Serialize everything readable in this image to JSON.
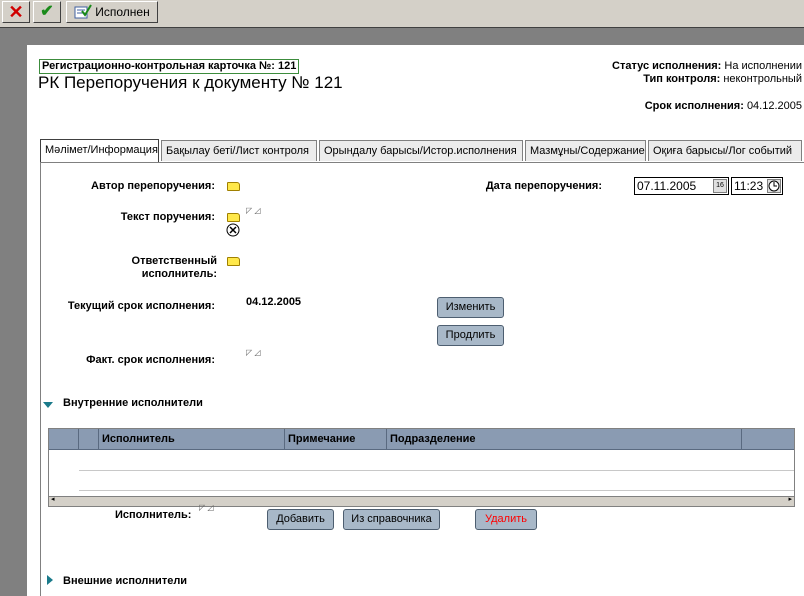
{
  "toolbar": {
    "close_label": "✕",
    "ok_label": "✔",
    "execute_label": "Исполнен"
  },
  "header": {
    "reg_card": "Регистрационно-контрольная карточка №: 121",
    "title": "РК Перепоручения к документу №  121",
    "status_label": "Статус исполнения:",
    "status_value": "На исполнении",
    "control_label": "Тип контроля:",
    "control_value": "неконтрольный",
    "deadline_label": "Срок исполнения:",
    "deadline_value": "04.12.2005"
  },
  "tabs": [
    {
      "label": "Мәлімет/Информация"
    },
    {
      "label": "Бақылау беті/Лист контроля"
    },
    {
      "label": "Орындалу барысы/Истор.исполнения"
    },
    {
      "label": "Мазмұны/Содержание"
    },
    {
      "label": "Оқиға барысы/Лог событий"
    }
  ],
  "form": {
    "author_label": "Автор перепоручения:",
    "text_label": "Текст поручения:",
    "responsible_label": "Ответственный исполнитель:",
    "current_deadline_label": "Текущий срок исполнения:",
    "current_deadline_value": "04.12.2005",
    "fact_deadline_label": "Факт. срок исполнения:",
    "date_label": "Дата перепоручения:",
    "date_value": "07.11.2005",
    "time_value": "11:23",
    "date_btn": "16",
    "change_btn": "Изменить",
    "extend_btn": "Продлить"
  },
  "internal": {
    "section_label": "Внутренние исполнители",
    "columns": [
      "Исполнитель",
      "Примечание",
      "Подразделение"
    ],
    "executor_label": "Исполнитель:",
    "add_btn": "Добавить",
    "from_dir_btn": "Из справочника",
    "delete_btn": "Удалить"
  },
  "external": {
    "section_label": "Внешние исполнители"
  },
  "colors": {
    "button_bg": "#a8b8c8",
    "grid_header": "#8a9bb2",
    "delete_text": "#ff0000",
    "section_arrow": "#1a7a8a"
  }
}
